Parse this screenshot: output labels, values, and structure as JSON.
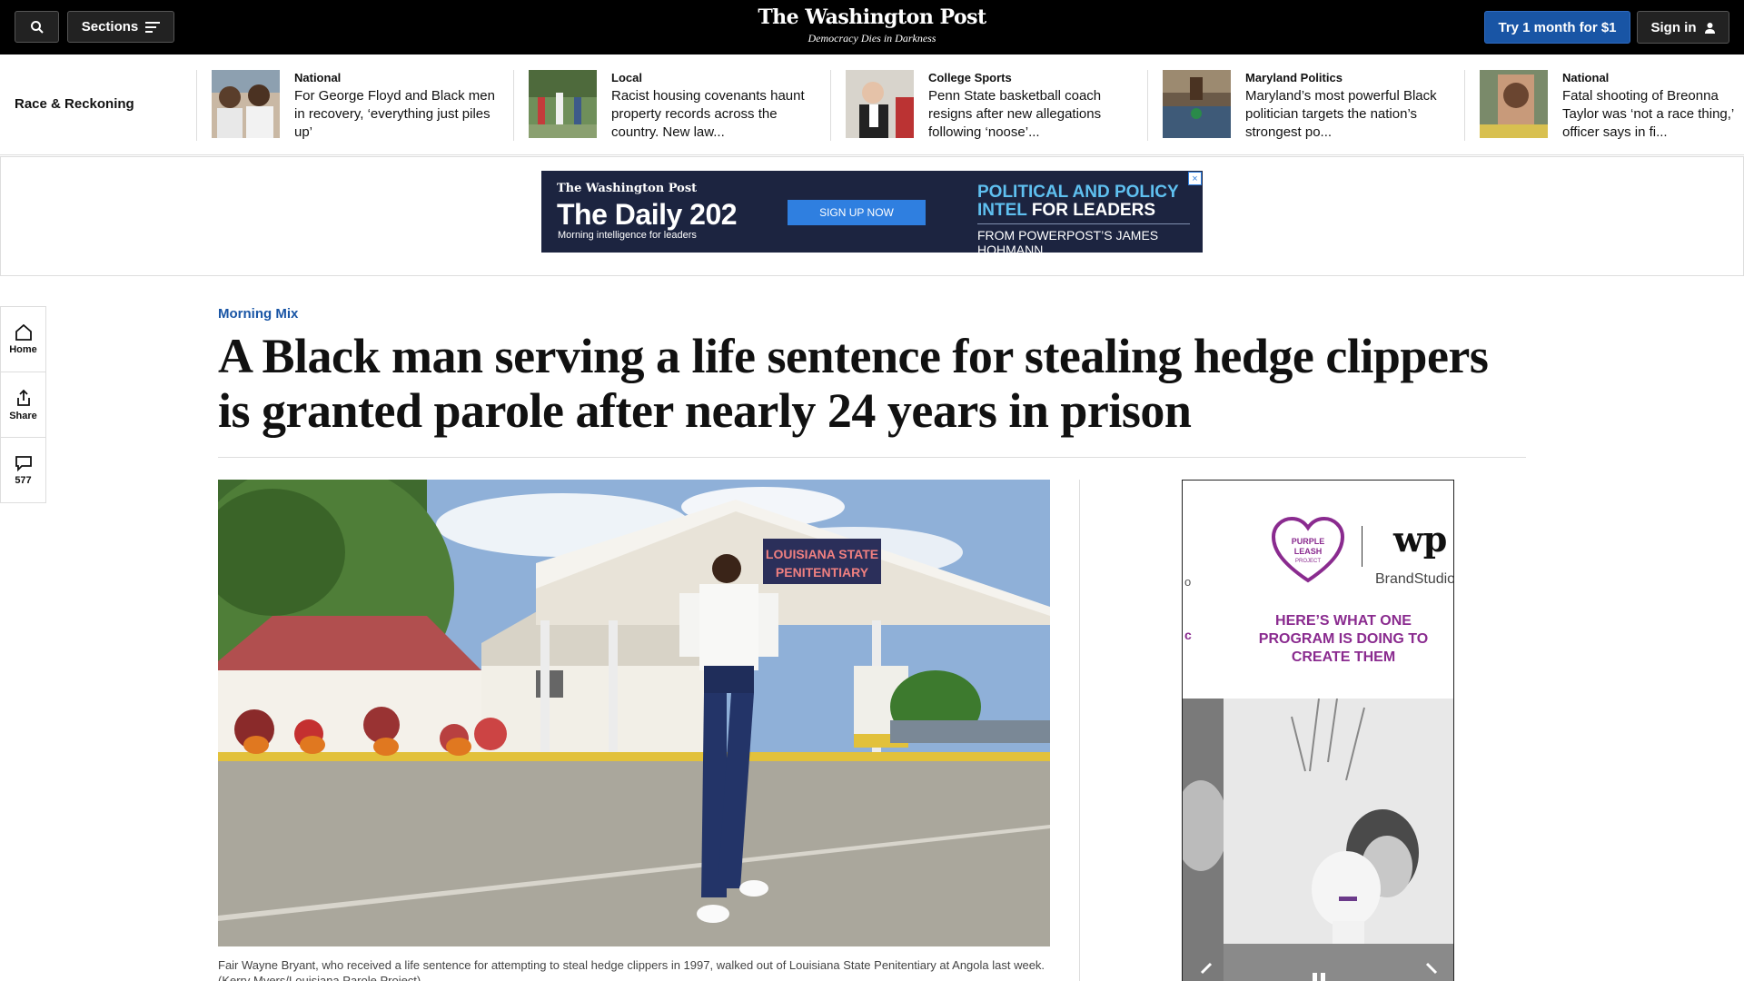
{
  "topbar": {
    "sections_label": "Sections",
    "logo": "The Washington Post",
    "tagline": "Democracy Dies in Darkness",
    "try_label": "Try 1 month for $1",
    "signin_label": "Sign in"
  },
  "rail": {
    "title": "Race & Reckoning",
    "items": [
      {
        "kicker": "National",
        "headline": "For George Floyd and Black men in recovery, ‘everything just piles up’"
      },
      {
        "kicker": "Local",
        "headline": "Racist housing covenants haunt property records across the country. New law..."
      },
      {
        "kicker": "College Sports",
        "headline": "Penn State basketball coach resigns after new allegations following ‘noose’..."
      },
      {
        "kicker": "Maryland Politics",
        "headline": "Maryland’s most powerful Black politician targets the nation’s strongest po..."
      },
      {
        "kicker": "National",
        "headline": "Fatal shooting of Breonna Taylor was ‘not a race thing,’ officer says in fi..."
      }
    ]
  },
  "ad_banner": {
    "logo": "The Washington Post",
    "title": "The Daily 202",
    "sub": "Morning intelligence for leaders",
    "cta": "SIGN UP NOW",
    "right_blue": "POLITICAL AND POLICY",
    "right_blue2": "INTEL",
    "right_white": "FOR LEADERS",
    "right_bottom": "FROM POWERPOST’S JAMES HOHMANN",
    "close": "×"
  },
  "utility": {
    "home": "Home",
    "share": "Share",
    "comments": "577"
  },
  "article": {
    "kicker": "Morning Mix",
    "headline": "A Black man serving a life sentence for stealing hedge clippers is granted parole after nearly 24 years in prison",
    "sign_line1": "LOUISIANA STATE",
    "sign_line2": "PENITENTIARY",
    "caption": "Fair Wayne Bryant, who received a life sentence for attempting to steal hedge clippers in 1997, walked out of Louisiana State Penitentiary at Angola last week. (Kerry Myers/Louisiana Parole Project)"
  },
  "side_ad": {
    "logo_text": "PURPLE LEASH PROJECT",
    "wp": "wp",
    "brand": "BrandStudio",
    "headline": "HERE’S WHAT ONE PROGRAM IS DOING TO CREATE THEM",
    "cross1": "o",
    "cross2": "c"
  },
  "colors": {
    "accent_blue": "#1955a5",
    "ad_purple": "#8a2b8f"
  }
}
